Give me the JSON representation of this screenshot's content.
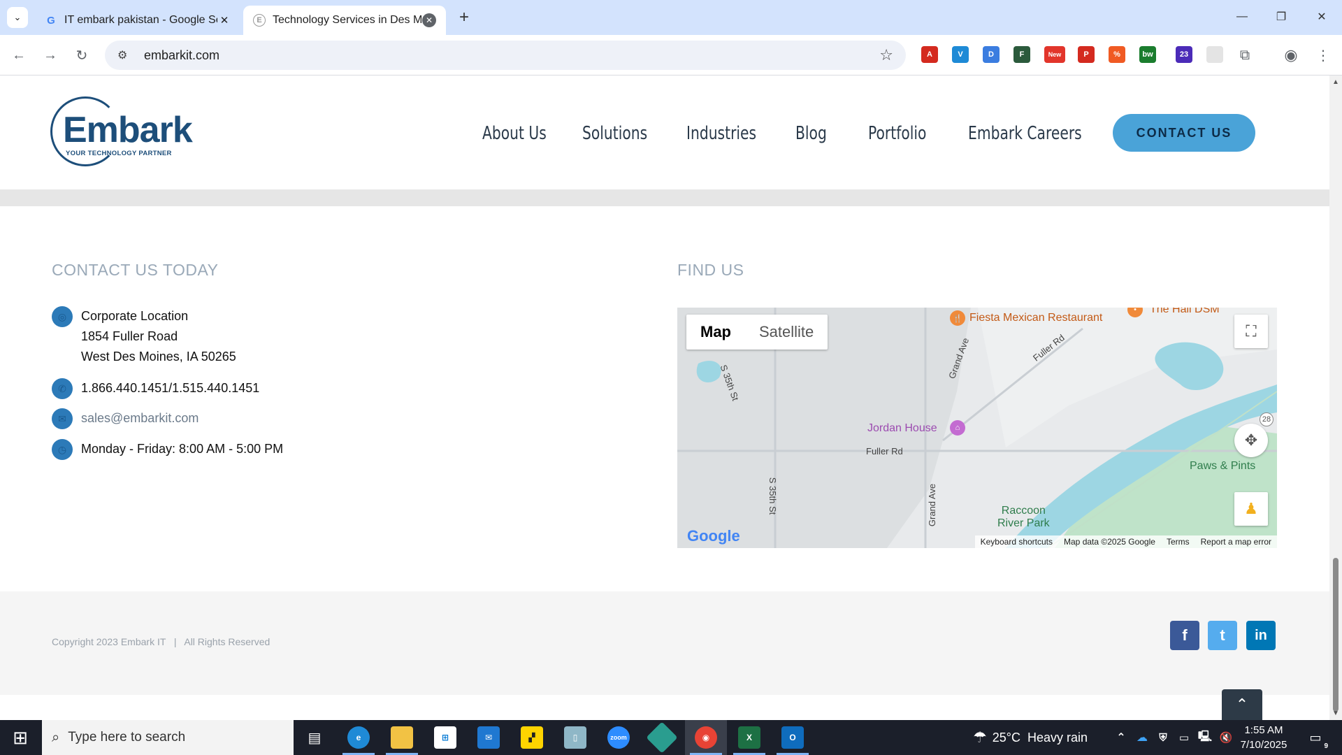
{
  "browser": {
    "tabs": [
      {
        "title": "IT embark pakistan - Google Se",
        "favicon": "G",
        "active": false
      },
      {
        "title": "Technology Services in Des Moi",
        "favicon": "E",
        "active": true
      }
    ],
    "url": "embarkit.com",
    "extensions": [
      {
        "name": "pdf-extension-icon",
        "color": "#d42a1f",
        "text": "A"
      },
      {
        "name": "shield-extension-icon",
        "color": "#1e8ad6",
        "text": "V"
      },
      {
        "name": "doc-extension-icon",
        "color": "#3b7de0",
        "text": "D"
      },
      {
        "name": "folder-extension-icon",
        "color": "#2b5a3c",
        "text": "F"
      },
      {
        "name": "new-extension-icon",
        "color": "#e2352b",
        "text": "New"
      },
      {
        "name": "pokeball-extension-icon",
        "color": "#d42a1f",
        "text": "P"
      },
      {
        "name": "percent-extension-icon",
        "color": "#f05a23",
        "text": "%"
      },
      {
        "name": "bw-extension-icon",
        "color": "#1b7d2e",
        "text": "bw"
      },
      {
        "name": "grad-extension-icon",
        "color": "#4b2bb8",
        "text": "23"
      },
      {
        "name": "blank-extension-icon",
        "color": "#e4e4e4",
        "text": ""
      }
    ]
  },
  "site": {
    "logo": {
      "word": "Embark",
      "tagline": "YOUR TECHNOLOGY PARTNER"
    },
    "nav": [
      "About Us",
      "Solutions",
      "Industries",
      "Blog",
      "Portfolio",
      "Embark Careers"
    ],
    "contact_button": "CONTACT US"
  },
  "contact": {
    "title": "CONTACT US TODAY",
    "location_lines": [
      "Corporate Location",
      "1854 Fuller Road",
      "West Des Moines, IA 50265"
    ],
    "phone": "1.866.440.1451/1.515.440.1451",
    "email": "sales@embarkit.com",
    "hours": "Monday - Friday: 8:00 AM - 5:00 PM"
  },
  "findus": {
    "title": "FIND US",
    "map": {
      "type_map": "Map",
      "type_satellite": "Satellite",
      "labels": {
        "fiesta": "Fiesta Mexican Restaurant",
        "hall": "The Hall DSM",
        "jordan": "Jordan House",
        "fuller": "Fuller Rd",
        "fuller_diag": "Fuller Rd",
        "grand1": "Grand Ave",
        "grand2": "Grand Ave",
        "s35a": "S 35th St",
        "s35b": "S 35th St",
        "raccoon": "Raccoon\nRiver Park",
        "paws": "Paws & Pints",
        "route": "28"
      },
      "footer": [
        "Keyboard shortcuts",
        "Map data ©2025 Google",
        "Terms",
        "Report a map error"
      ],
      "google": "Google"
    }
  },
  "footer": {
    "copyright": "Copyright 2023 Embark IT   |   All Rights Reserved",
    "social": [
      {
        "name": "facebook",
        "glyph": "f",
        "color": "#3b5998"
      },
      {
        "name": "twitter",
        "glyph": "t",
        "color": "#55acee"
      },
      {
        "name": "linkedin",
        "glyph": "in",
        "color": "#0077b5"
      }
    ]
  },
  "taskbar": {
    "search_placeholder": "Type here to search",
    "weather": "25°C  Heavy rain",
    "time": "1:55 AM",
    "date": "7/10/2025",
    "notification_count": "9"
  }
}
